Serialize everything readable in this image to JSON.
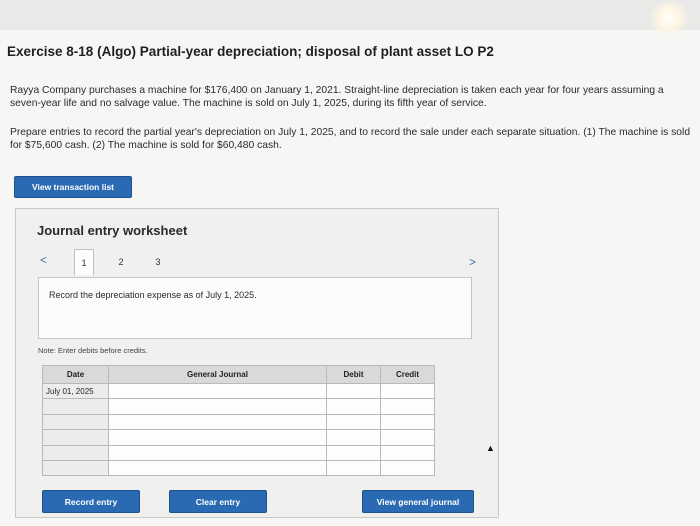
{
  "exercise": {
    "title": "Exercise 8-18 (Algo) Partial-year depreciation; disposal of plant asset LO P2",
    "paragraph1": "Rayya Company purchases a machine for $176,400 on January 1, 2021. Straight-line depreciation is taken each year for four years assuming a seven-year life and no salvage value. The machine is sold on July 1, 2025, during its fifth year of service.",
    "paragraph2": "Prepare entries to record the partial year's depreciation on July 1, 2025, and to record the sale under each separate situation. (1) The machine is sold for $75,600 cash. (2) The machine is sold for $60,480 cash."
  },
  "buttons": {
    "view_transaction_list": "View transaction list",
    "record_entry": "Record entry",
    "clear_entry": "Clear entry",
    "view_general_journal": "View general journal"
  },
  "worksheet": {
    "title": "Journal entry worksheet",
    "tabs": [
      "1",
      "2",
      "3"
    ],
    "active_tab": "1",
    "instruction": "Record the depreciation expense as of July 1, 2025.",
    "note": "Note: Enter debits before credits.",
    "columns": [
      "Date",
      "General Journal",
      "Debit",
      "Credit"
    ],
    "rows": [
      {
        "date": "July 01, 2025",
        "account": "",
        "debit": "",
        "credit": ""
      },
      {
        "date": "",
        "account": "",
        "debit": "",
        "credit": ""
      },
      {
        "date": "",
        "account": "",
        "debit": "",
        "credit": ""
      },
      {
        "date": "",
        "account": "",
        "debit": "",
        "credit": ""
      },
      {
        "date": "",
        "account": "",
        "debit": "",
        "credit": ""
      },
      {
        "date": "",
        "account": "",
        "debit": "",
        "credit": ""
      }
    ]
  },
  "icons": {
    "prev": "chevron-left-icon",
    "next": "chevron-right-icon"
  },
  "colors": {
    "button_blue": "#2a6ab3",
    "nav_blue": "#4a6fa0"
  }
}
